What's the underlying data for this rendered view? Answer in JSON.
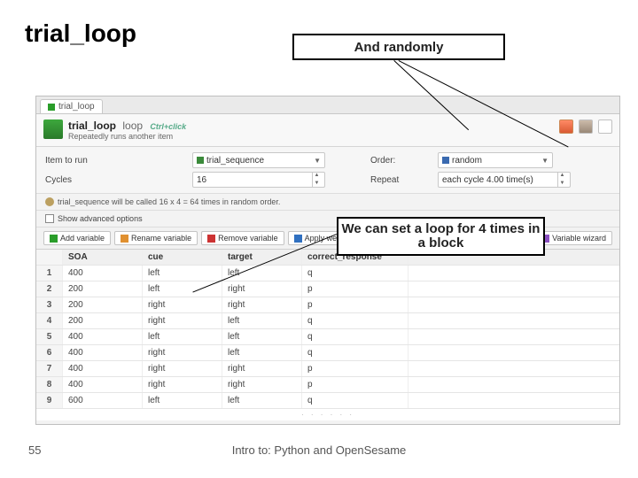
{
  "slide": {
    "title": "trial_loop",
    "page_num": "55",
    "footer": "Intro to: Python and OpenSesame"
  },
  "callouts": {
    "c1": "And randomly",
    "c2": "We can set a loop for 4 times in a block"
  },
  "tab": {
    "label": "trial_loop"
  },
  "header": {
    "title": "trial_loop",
    "type": "loop",
    "hint": "Ctrl+click",
    "subtitle": "Repeatedly runs another item"
  },
  "fields": {
    "item_label": "Item to run",
    "item_value": "trial_sequence",
    "order_label": "Order:",
    "order_value": "random",
    "cycles_label": "Cycles",
    "cycles_value": "16",
    "repeat_label": "Repeat",
    "repeat_value": "each cycle 4.00 time(s)"
  },
  "summary": "trial_sequence will be called 16 x 4 = 64 times in random order.",
  "option": "Show advanced options",
  "toolbar": {
    "add": "Add variable",
    "rename": "Rename variable",
    "remove": "Remove variable",
    "weights": "Apply weights",
    "wizard": "Variable wizard"
  },
  "columns": [
    "",
    "SOA",
    "cue",
    "target",
    "correct_response"
  ],
  "rows": [
    [
      "1",
      "400",
      "left",
      "left",
      "q"
    ],
    [
      "2",
      "200",
      "left",
      "right",
      "p"
    ],
    [
      "3",
      "200",
      "right",
      "right",
      "p"
    ],
    [
      "4",
      "200",
      "right",
      "left",
      "q"
    ],
    [
      "5",
      "400",
      "left",
      "left",
      "q"
    ],
    [
      "6",
      "400",
      "right",
      "left",
      "q"
    ],
    [
      "7",
      "400",
      "right",
      "right",
      "p"
    ],
    [
      "8",
      "400",
      "right",
      "right",
      "p"
    ],
    [
      "9",
      "600",
      "left",
      "left",
      "q"
    ]
  ]
}
